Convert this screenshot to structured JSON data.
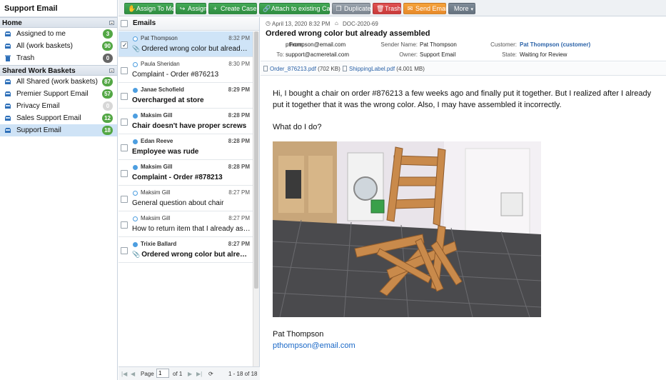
{
  "sidebar": {
    "title": "Support Email",
    "groups": [
      {
        "label": "Home",
        "items": [
          {
            "label": "Assigned to me",
            "badge": "3"
          },
          {
            "label": "All (work baskets)",
            "badge": "90"
          },
          {
            "label": "Trash",
            "badge": "0"
          }
        ]
      },
      {
        "label": "Shared Work Baskets",
        "items": [
          {
            "label": "All Shared (work baskets)",
            "badge": "87"
          },
          {
            "label": "Premier Support Email",
            "badge": "57"
          },
          {
            "label": "Privacy Email",
            "badge": "0"
          },
          {
            "label": "Sales Support Email",
            "badge": "12"
          },
          {
            "label": "Support Email",
            "badge": "18"
          }
        ]
      }
    ]
  },
  "toolbar": {
    "assign_to_me": "Assign To Me",
    "assign": "Assign",
    "create_case": "Create Case",
    "attach_existing": "Attach to existing Case",
    "duplicate": "Duplicate",
    "trash": "Trash",
    "send_email": "Send Email",
    "more": "More"
  },
  "list": {
    "header": "Emails",
    "rows": [
      {
        "sender": "Pat Thompson",
        "time": "8:32 PM",
        "subject": "Ordered wrong color but already assembled",
        "unread": false,
        "attachment": true,
        "checked": true,
        "selected": true
      },
      {
        "sender": "Paula Sheridan",
        "time": "8:30 PM",
        "subject": "Complaint - Order #876213",
        "unread": false,
        "attachment": false,
        "checked": false,
        "selected": false
      },
      {
        "sender": "Janae Schofield",
        "time": "8:29 PM",
        "subject": "Overcharged at store",
        "unread": true,
        "attachment": false,
        "checked": false,
        "selected": false
      },
      {
        "sender": "Maksim Gill",
        "time": "8:28 PM",
        "subject": "Chair doesn't have proper screws",
        "unread": true,
        "attachment": false,
        "checked": false,
        "selected": false
      },
      {
        "sender": "Edan Reeve",
        "time": "8:28 PM",
        "subject": "Employee was rude",
        "unread": true,
        "attachment": false,
        "checked": false,
        "selected": false
      },
      {
        "sender": "Maksim Gill",
        "time": "8:28 PM",
        "subject": "Complaint - Order #878213",
        "unread": true,
        "attachment": false,
        "checked": false,
        "selected": false
      },
      {
        "sender": "Maksim Gill",
        "time": "8:27 PM",
        "subject": "General question about chair",
        "unread": false,
        "attachment": false,
        "checked": false,
        "selected": false
      },
      {
        "sender": "Maksim Gill",
        "time": "8:27 PM",
        "subject": "How to return item that I already assembled",
        "unread": false,
        "attachment": false,
        "checked": false,
        "selected": false
      },
      {
        "sender": "Trixie Ballard",
        "time": "8:27 PM",
        "subject": "Ordered wrong color but already assembled",
        "unread": true,
        "attachment": true,
        "checked": false,
        "selected": false
      }
    ],
    "pager": {
      "page_label": "Page",
      "page_value": "1",
      "of_label": "of 1",
      "range": "1 - 18 of 18"
    }
  },
  "message": {
    "date": "April 13, 2020 8:32 PM",
    "doc_id": "DOC-2020-69",
    "subject": "Ordered wrong color but already assembled",
    "from_label": "From:",
    "from_value": "pthompson@email.com",
    "to_label": "To:",
    "to_value": "support@acmeretail.com",
    "sender_name_label": "Sender Name:",
    "sender_name_value": "Pat Thompson",
    "owner_label": "Owner:",
    "owner_value": "Support Email",
    "customer_label": "Customer:",
    "customer_value": "Pat Thompson (customer)",
    "state_label": "State:",
    "state_value": "Waiting for Review",
    "attachments": [
      {
        "name": "Order_876213.pdf",
        "size": "(702 KB)"
      },
      {
        "name": "ShippingLabel.pdf",
        "size": "(4.001 MB)"
      }
    ],
    "body_paragraph_1": "Hi, I bought a chair on order #876213 a few weeks ago and finally put it together. But I realized after I already put it together that it was the wrong color. Also, I may have assembled it incorrectly.",
    "body_paragraph_2": "What do I do?",
    "signature_name": "Pat Thompson",
    "signature_email": "pthompson@email.com"
  }
}
